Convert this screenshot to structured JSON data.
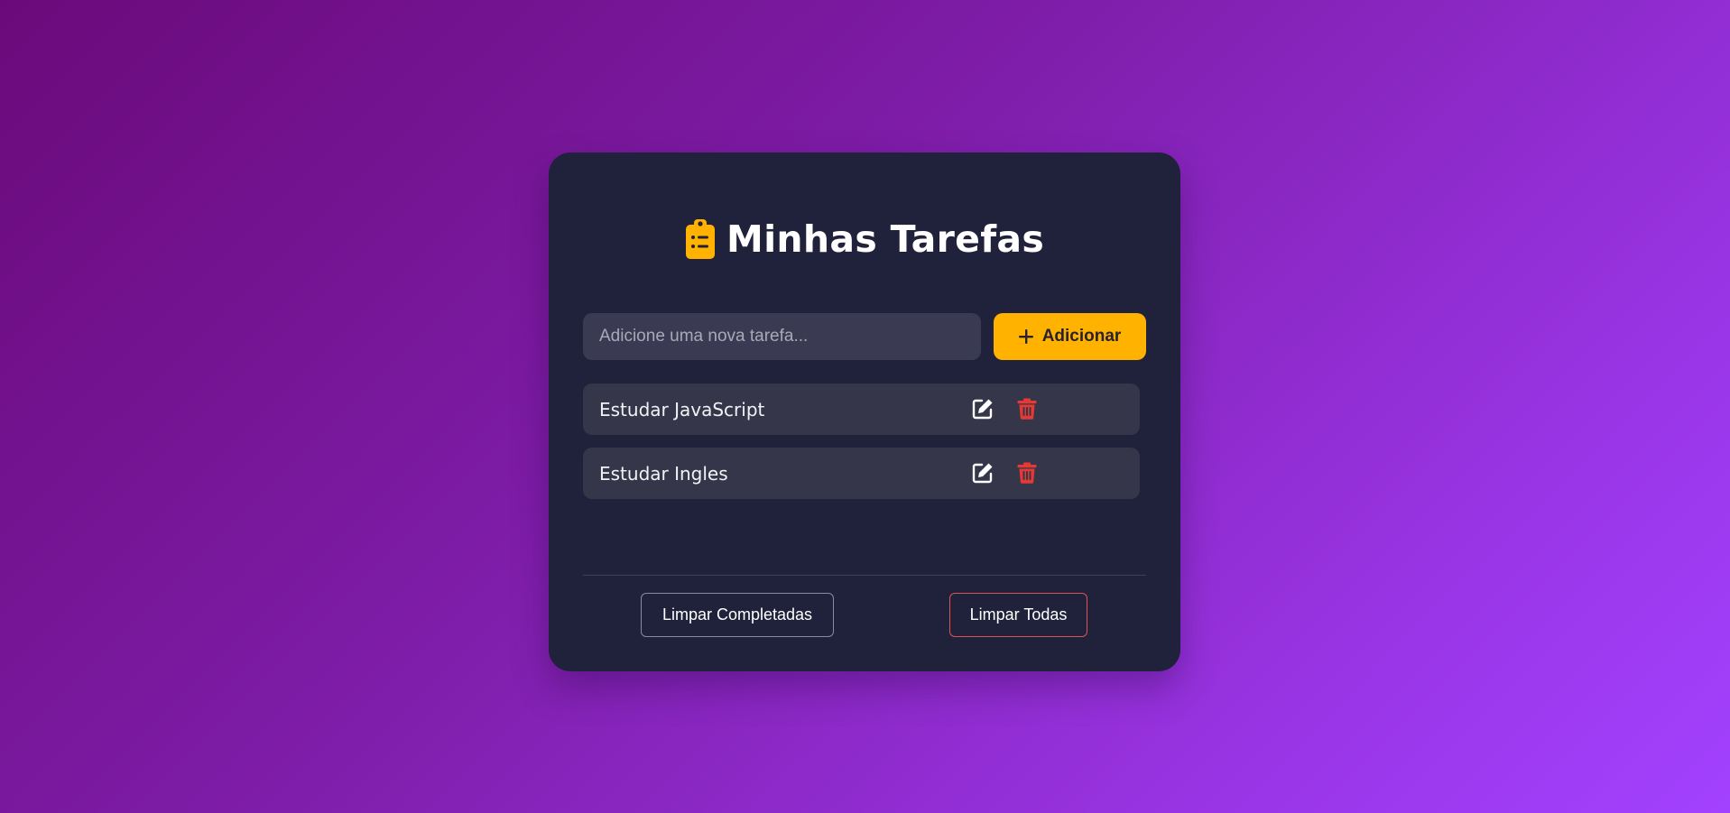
{
  "app": {
    "title": "Minhas Tarefas",
    "title_icon": "clipboard-list-icon"
  },
  "input": {
    "placeholder": "Adicione uma nova tarefa...",
    "value": ""
  },
  "add_button": {
    "label": "Adicionar",
    "icon": "plus-icon"
  },
  "tasks": [
    {
      "text": "Estudar JavaScript",
      "edit_icon": "edit-icon",
      "delete_icon": "trash-icon"
    },
    {
      "text": "Estudar Ingles",
      "edit_icon": "edit-icon",
      "delete_icon": "trash-icon"
    }
  ],
  "footer": {
    "clear_completed_label": "Limpar Completadas",
    "clear_all_label": "Limpar Todas"
  },
  "colors": {
    "accent": "#ffb300",
    "card_background": "#20213a",
    "task_background": "#353649",
    "delete_red": "#e53935",
    "clear_all_border": "#e05252"
  }
}
